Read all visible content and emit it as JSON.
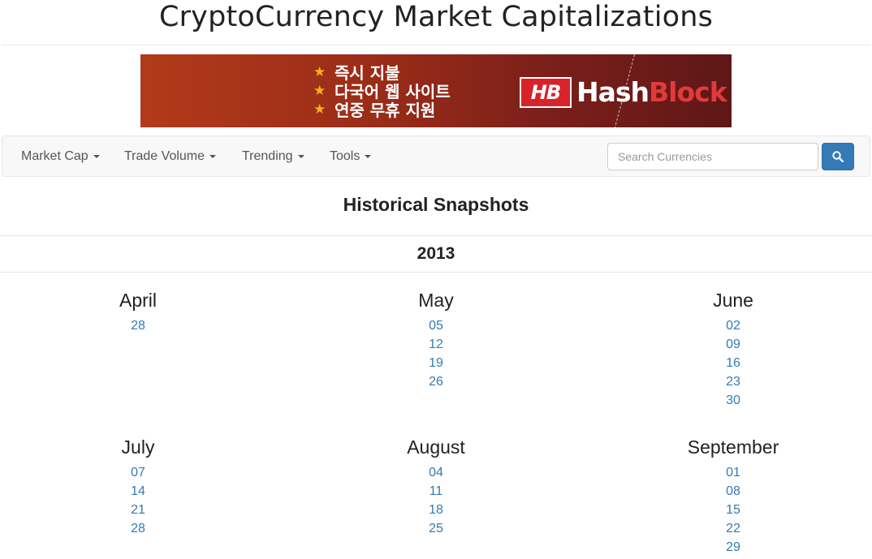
{
  "site": {
    "title": "CryptoCurrency Market Capitalizations"
  },
  "banner": {
    "lines": [
      "즉시 지불",
      "다국어 웹 사이트",
      "연중 무휴 지원"
    ],
    "logo_badge": "HB",
    "logo_text_1": "Hash",
    "logo_text_2": "Block"
  },
  "nav": {
    "items": [
      "Market Cap",
      "Trade Volume",
      "Trending",
      "Tools"
    ],
    "search_placeholder": "Search Currencies"
  },
  "page": {
    "heading": "Historical Snapshots",
    "year": "2013"
  },
  "months": [
    {
      "name": "April",
      "days": [
        "28"
      ]
    },
    {
      "name": "May",
      "days": [
        "05",
        "12",
        "19",
        "26"
      ]
    },
    {
      "name": "June",
      "days": [
        "02",
        "09",
        "16",
        "23",
        "30"
      ]
    },
    {
      "name": "July",
      "days": [
        "07",
        "14",
        "21",
        "28"
      ]
    },
    {
      "name": "August",
      "days": [
        "04",
        "11",
        "18",
        "25"
      ]
    },
    {
      "name": "September",
      "days": [
        "01",
        "08",
        "15",
        "22",
        "29"
      ]
    }
  ],
  "colors": {
    "link": "#337ab7",
    "primary_button": "#337ab7",
    "banner_accent": "#f5b21b"
  }
}
